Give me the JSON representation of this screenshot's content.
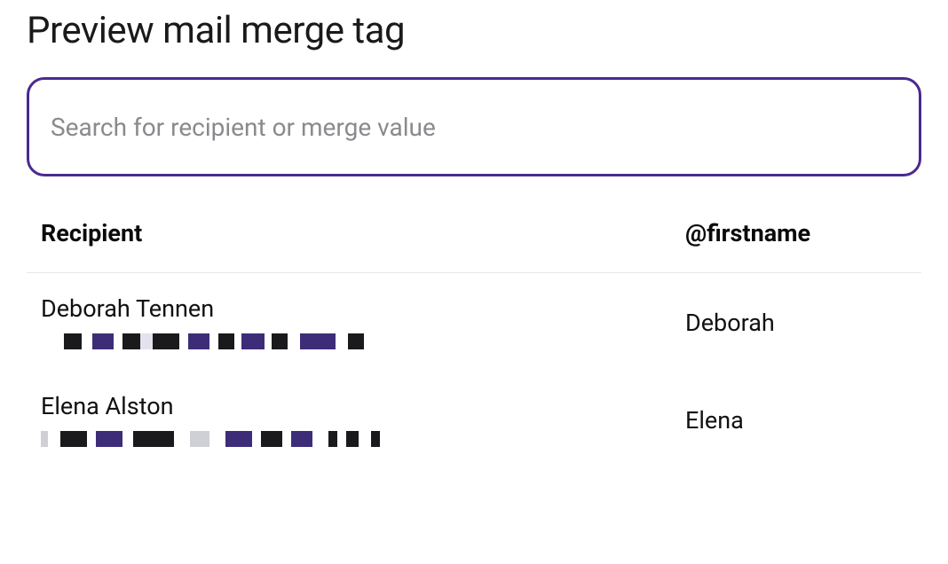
{
  "title": "Preview mail merge tag",
  "search": {
    "placeholder": "Search for recipient or merge value",
    "value": ""
  },
  "table": {
    "headers": {
      "recipient": "Recipient",
      "merge_tag": "@firstname"
    },
    "rows": [
      {
        "name": "Deborah Tennen",
        "merge_value": "Deborah"
      },
      {
        "name": "Elena Alston",
        "merge_value": "Elena"
      }
    ]
  },
  "redaction_colors": {
    "dark": "#1a191c",
    "purple": "#3d2d79",
    "light": "#ffffff",
    "gray": "#cfcfd6"
  }
}
